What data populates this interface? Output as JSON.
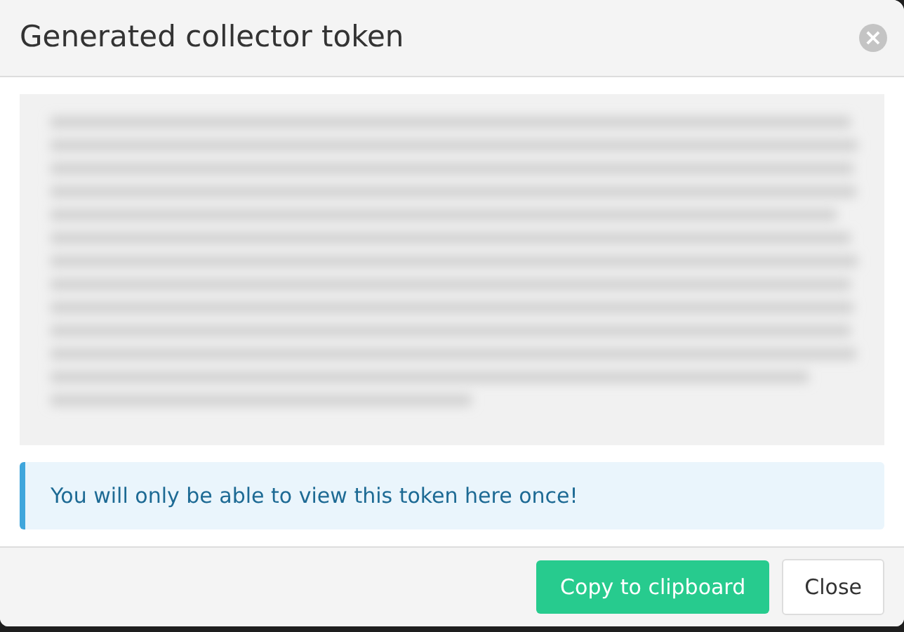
{
  "dialog": {
    "title": "Generated collector token",
    "close_icon": "×"
  },
  "notice": "You will only be able to view this token here once!",
  "buttons": [
    {
      "label": "Copy to clipboard",
      "kind": "primary"
    },
    {
      "label": "Close",
      "kind": "secondary"
    }
  ]
}
